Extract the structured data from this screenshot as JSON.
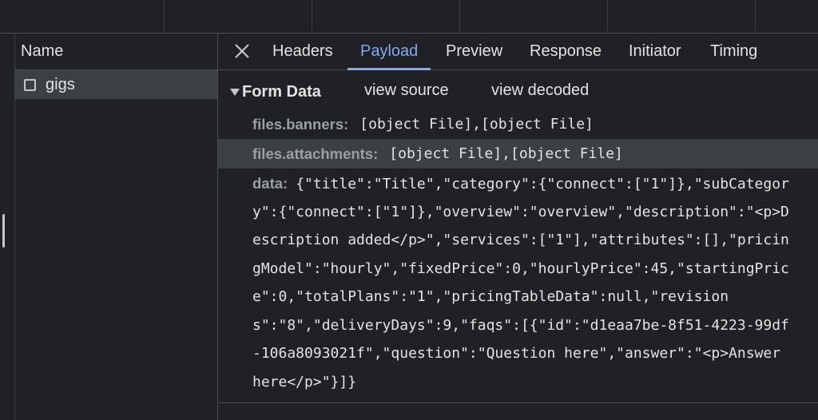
{
  "name_panel": {
    "header": "Name",
    "items": [
      {
        "label": "gigs"
      }
    ]
  },
  "tabs": [
    {
      "label": "Headers"
    },
    {
      "label": "Payload"
    },
    {
      "label": "Preview"
    },
    {
      "label": "Response"
    },
    {
      "label": "Initiator"
    },
    {
      "label": "Timing"
    }
  ],
  "active_tab": "Payload",
  "form_data": {
    "title": "Form Data",
    "view_source": "view source",
    "view_decoded": "view decoded",
    "fields": [
      {
        "key": "files.banners:",
        "value": "[object File],[object File]"
      },
      {
        "key": "files.attachments:",
        "value": "[object File],[object File]"
      }
    ],
    "data_key": "data:",
    "data_lines": [
      "{\"title\":\"Title\",\"category\":{\"connect\":[\"1\"]},\"subCategor",
      "y\":{\"connect\":[\"1\"]},\"overview\":\"overview\",\"description\":\"<p>D",
      "escription added</p>\",\"services\":[\"1\"],\"attributes\":[],\"pricin",
      "gModel\":\"hourly\",\"fixedPrice\":0,\"hourlyPrice\":45,\"startingPric",
      "e\":0,\"totalPlans\":\"1\",\"pricingTableData\":null,\"revision",
      "s\":\"8\",\"deliveryDays\":9,\"faqs\":[{\"id\":\"d1eaa7be-8f51-4223-99df",
      "-106a8093021f\",\"question\":\"Question here\",\"answer\":\"<p>Answer",
      "here</p>\"}]}"
    ]
  },
  "colors": {
    "background": "#202124",
    "accent": "#7cacf8",
    "highlight_row": "#3c4043"
  }
}
